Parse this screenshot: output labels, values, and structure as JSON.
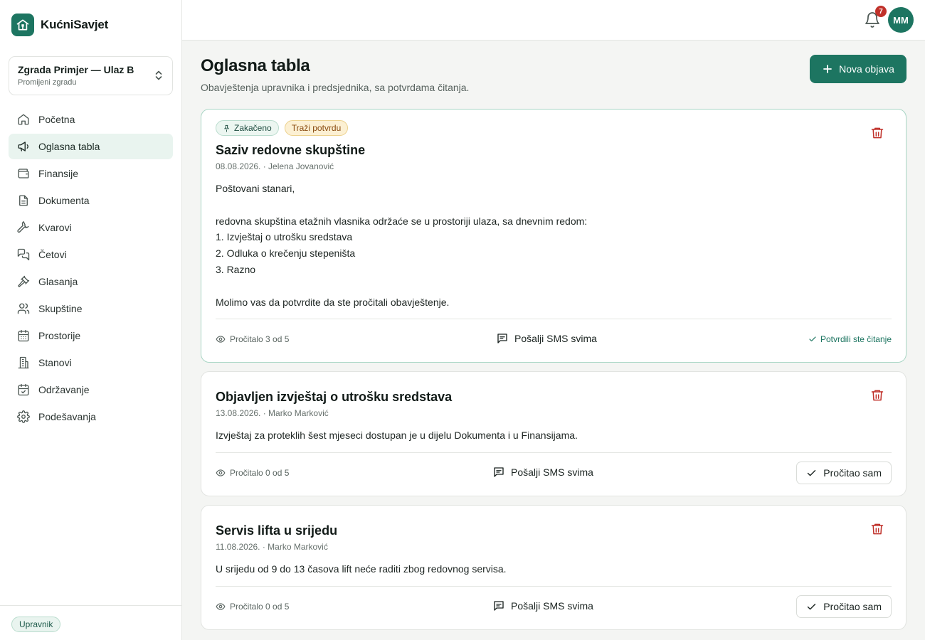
{
  "brand": {
    "name": "KućniSavjet",
    "logo_icon": "house-icon",
    "accent": "#1d7561"
  },
  "building": {
    "name": "Zgrada Primjer — Ulaz B",
    "change_label": "Promijeni zgradu"
  },
  "nav": [
    {
      "label": "Početna",
      "icon": "home-icon",
      "active": false
    },
    {
      "label": "Oglasna tabla",
      "icon": "megaphone-icon",
      "active": true
    },
    {
      "label": "Finansije",
      "icon": "wallet-icon",
      "active": false
    },
    {
      "label": "Dokumenta",
      "icon": "document-icon",
      "active": false
    },
    {
      "label": "Kvarovi",
      "icon": "wrench-icon",
      "active": false
    },
    {
      "label": "Četovi",
      "icon": "chat-icon",
      "active": false
    },
    {
      "label": "Glasanja",
      "icon": "gavel-icon",
      "active": false
    },
    {
      "label": "Skupštine",
      "icon": "users-icon",
      "active": false
    },
    {
      "label": "Prostorije",
      "icon": "calendar-icon",
      "active": false
    },
    {
      "label": "Stanovi",
      "icon": "building-icon",
      "active": false
    },
    {
      "label": "Održavanje",
      "icon": "calendar-check-icon",
      "active": false
    },
    {
      "label": "Podešavanja",
      "icon": "settings-icon",
      "active": false
    }
  ],
  "role": "Upravnik",
  "topbar": {
    "notifications_count": "7",
    "avatar_initials": "MM"
  },
  "page": {
    "title": "Oglasna tabla",
    "subtitle": "Obavještenja upravnika i predsjednika, sa potvrdama čitanja.",
    "new_post_label": "Nova objava"
  },
  "posts": [
    {
      "pinned_label": "Zakačeno",
      "confirm_label": "Traži potvrdu",
      "title": "Saziv redovne skupštine",
      "meta": "08.08.2026. · Jelena Jovanović",
      "body": "Poštovani stanari,\n\nredovna skupština etažnih vlasnika održaće se u prostoriji ulaza, sa dnevnim redom:\n1. Izvještaj o utrošku sredstava\n2. Odluka o krečenju stepeništa\n3. Razno\n\nMolimo vas da potvrdite da ste pročitali obavještenje.",
      "reads": "Pročitalo 3 od 5",
      "sms_label": "Pošalji SMS svima",
      "confirmed_label": "Potvrdili ste čitanje"
    },
    {
      "title": "Objavljen izvještaj o utrošku sredstava",
      "meta": "13.08.2026. · Marko Marković",
      "body": "Izvještaj za proteklih šest mjeseci dostupan je u dijelu Dokumenta i u Finansijama.",
      "reads": "Pročitalo 0 od 5",
      "sms_label": "Pošalji SMS svima",
      "read_button_label": "Pročitao sam"
    },
    {
      "title": "Servis lifta u srijedu",
      "meta": "11.08.2026. · Marko Marković",
      "body": "U srijedu od 9 do 13 časova lift neće raditi zbog redovnog servisa.",
      "reads": "Pročitalo 0 od 5",
      "sms_label": "Pošalji SMS svima",
      "read_button_label": "Pročitao sam"
    }
  ]
}
